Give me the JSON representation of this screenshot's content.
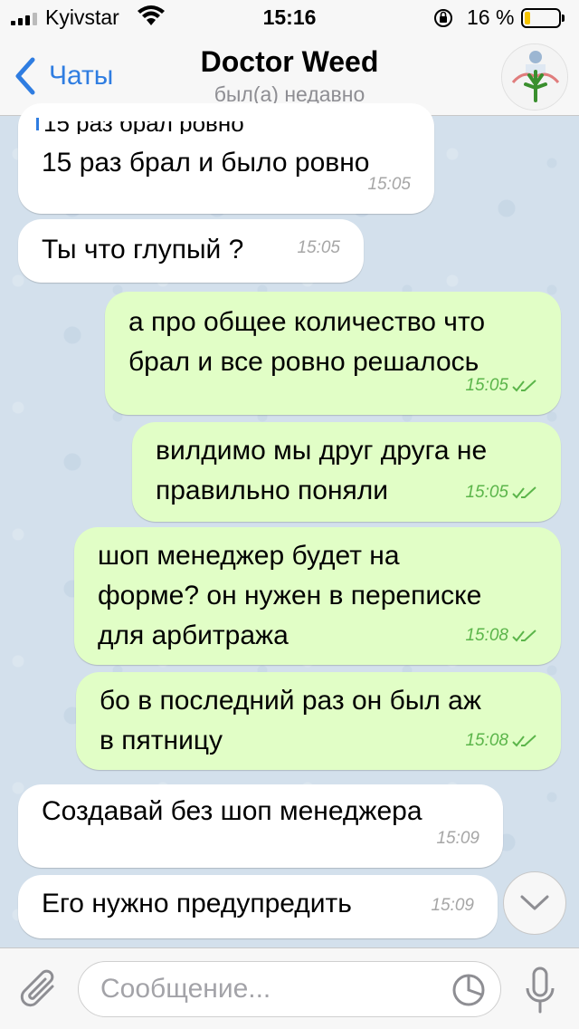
{
  "status_bar": {
    "carrier": "Kyivstar",
    "time": "15:16",
    "battery_percent": "16 %",
    "battery_level": 0.16,
    "battery_color": "#f5c400"
  },
  "nav": {
    "back_label": "Чаты",
    "title": "Doctor Weed",
    "subtitle": "был(а) недавно"
  },
  "quote": {
    "text": "15 раз брал ровно"
  },
  "messages": [
    {
      "dir": "in",
      "text": "15 раз брал и было ровно",
      "time": "15:05"
    },
    {
      "dir": "in",
      "text": "Ты что глупый ?",
      "time": "15:05"
    },
    {
      "dir": "out",
      "text": "а про общее количество что\nбрал и все ровно решалось",
      "time": "15:05",
      "read": true
    },
    {
      "dir": "out",
      "text": "вилдимо мы друг друга не\nправильно поняли",
      "time": "15:05",
      "read": true
    },
    {
      "dir": "out",
      "text": "шоп менеджер будет на\nформе? он нужен в переписке\nдля арбитража",
      "time": "15:08",
      "read": true
    },
    {
      "dir": "out",
      "text": "бо в последний раз он был аж\nв пятницу",
      "time": "15:08",
      "read": true
    },
    {
      "dir": "in",
      "text": "Создавай без шоп менеджера",
      "time": "15:09"
    },
    {
      "dir": "in",
      "text": "Его нужно предупредить",
      "time": "15:09"
    }
  ],
  "composer": {
    "placeholder": "Сообщение..."
  },
  "colors": {
    "accent": "#2f7de1",
    "outgoing_bubble": "#e1fec6",
    "incoming_bubble": "#ffffff",
    "read_ticks": "#5bb54a"
  },
  "icons": {
    "back": "chevron-left-icon",
    "scroll": "chevron-down-icon",
    "attach": "paperclip-icon",
    "sticker": "sticker-icon",
    "mic": "microphone-icon"
  }
}
